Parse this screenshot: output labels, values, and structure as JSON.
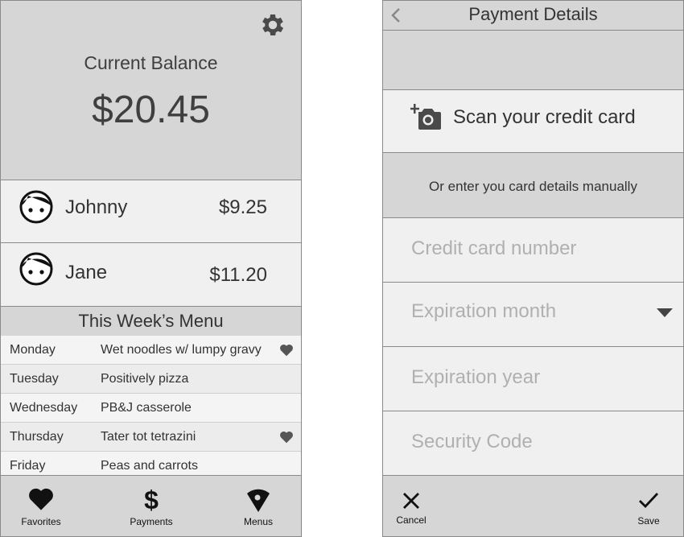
{
  "balance": {
    "label": "Current Balance",
    "amount": "$20.45"
  },
  "children": [
    {
      "name": "Johnny",
      "amount": "$9.25"
    },
    {
      "name": "Jane",
      "amount": "$11.20"
    }
  ],
  "menu": {
    "title": "This Week’s Menu",
    "rows": [
      {
        "day": "Monday",
        "dish": "Wet noodles w/ lumpy gravy",
        "favorite": true
      },
      {
        "day": "Tuesday",
        "dish": "Positively pizza",
        "favorite": false
      },
      {
        "day": "Wednesday",
        "dish": "PB&J casserole",
        "favorite": false
      },
      {
        "day": "Thursday",
        "dish": "Tater tot tetrazini",
        "favorite": true
      },
      {
        "day": "Friday",
        "dish": "Peas and carrots",
        "favorite": false
      }
    ]
  },
  "tabs": [
    {
      "label": "Favorites",
      "icon": "heart-icon"
    },
    {
      "label": "Payments",
      "icon": "dollar-icon"
    },
    {
      "label": "Menus",
      "icon": "pizza-icon"
    }
  ],
  "payment": {
    "title": "Payment Details",
    "scan_label": "Scan your credit card",
    "manual_label": "Or enter you card details manually",
    "fields": {
      "card_number": "Credit card number",
      "exp_month": "Expiration month",
      "exp_year": "Expiration year",
      "security_code": "Security Code"
    },
    "cancel_label": "Cancel",
    "save_label": "Save"
  },
  "colors": {
    "panel": "#d6d6d6",
    "cell": "#f0f0f0",
    "border": "#8a8a8a",
    "text": "#333333",
    "placeholder": "#b0b0b0"
  }
}
